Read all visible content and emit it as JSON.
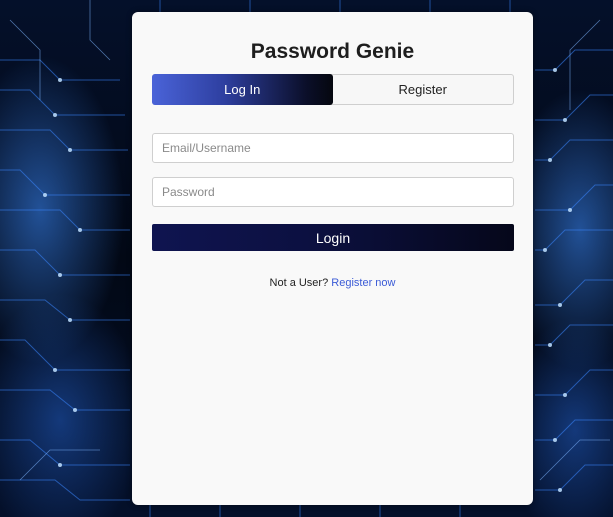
{
  "app": {
    "title": "Password Genie"
  },
  "tabs": [
    {
      "label": "Log In",
      "active": true
    },
    {
      "label": "Register",
      "active": false
    }
  ],
  "form": {
    "email_placeholder": "Email/Username",
    "email_value": "",
    "password_placeholder": "Password",
    "password_value": "",
    "submit_label": "Login"
  },
  "footer": {
    "prompt_text": "Not a User?",
    "register_link_label": "Register now"
  },
  "colors": {
    "card_background": "#f9f9f9",
    "active_tab_gradient_start": "#4a63d8",
    "active_tab_gradient_end": "#05070f",
    "login_button": "#0f1450",
    "link": "#3b5bd6"
  }
}
